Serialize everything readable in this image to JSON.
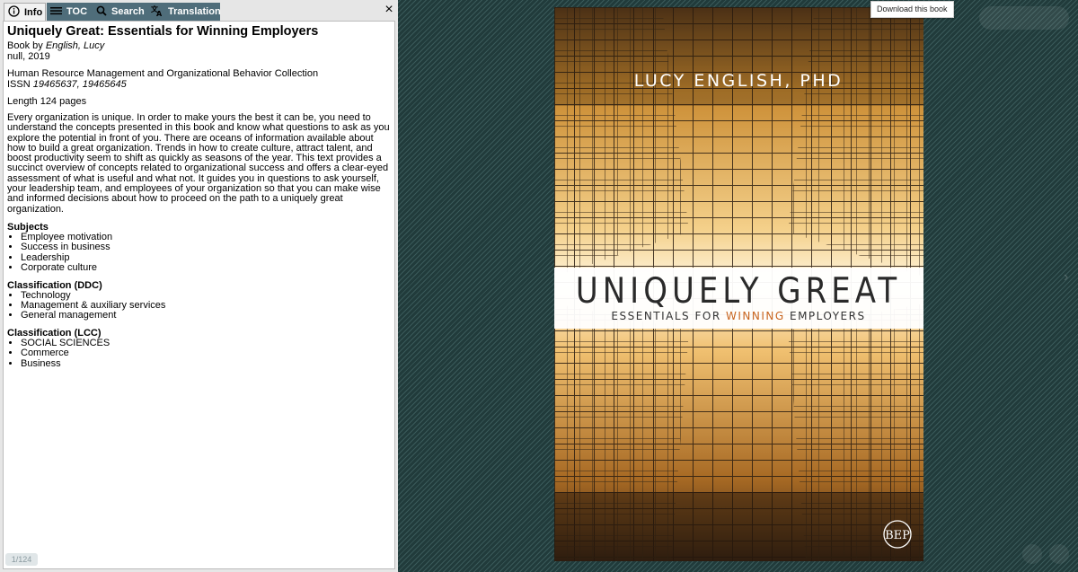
{
  "tabs": {
    "info": "Info",
    "toc": "TOC",
    "search": "Search",
    "translation": "Translation"
  },
  "close_icon": "×",
  "book": {
    "title": "Uniquely Great: Essentials for Winning Employers",
    "byline_prefix": "Book by ",
    "author": "English, Lucy",
    "publisher_year": "null, 2019",
    "collection": "Human Resource Management and Organizational Behavior Collection",
    "issn_prefix": "ISSN ",
    "issn": "19465637, 19465645",
    "length": "Length 124 pages",
    "description": "Every organization is unique. In order to make yours the best it can be, you need to understand the concepts presented in this book and know what questions to ask as you explore the potential in front of you. There are oceans of information available about how to build a great organization. Trends in how to create culture, attract talent, and boost productivity seem to shift as quickly as seasons of the year. This text provides a succinct overview of concepts related to organizational success and offers a clear-eyed assessment of what is useful and what not. It guides you in questions to ask yourself, your leadership team, and employees of your organization so that you can make wise and informed decisions about how to proceed on the path to a uniquely great organization."
  },
  "subjects": {
    "title": "Subjects",
    "items": [
      "Employee motivation",
      "Success in business",
      "Leadership",
      "Corporate culture"
    ]
  },
  "ddc": {
    "title": "Classification (DDC)",
    "items": [
      "Technology",
      "Management & auxiliary services",
      "General management"
    ]
  },
  "lcc": {
    "title": "Classification (LCC)",
    "items": [
      "SOCIAL SCIENCES",
      "Commerce",
      "Business"
    ]
  },
  "page_counter": "1/124",
  "download_tooltip": "Download this book",
  "cover": {
    "author": "LUCY ENGLISH, PHD",
    "title": "UNIQUELY GREAT",
    "subtitle_before": "ESSENTIALS FOR ",
    "subtitle_highlight": "WINNING",
    "subtitle_after": " EMPLOYERS",
    "publisher": "BEP",
    "accent_color": "#c8641e"
  },
  "icons": {
    "info": "info-icon",
    "toc": "list-icon",
    "search": "search-icon",
    "translation": "translate-icon"
  }
}
